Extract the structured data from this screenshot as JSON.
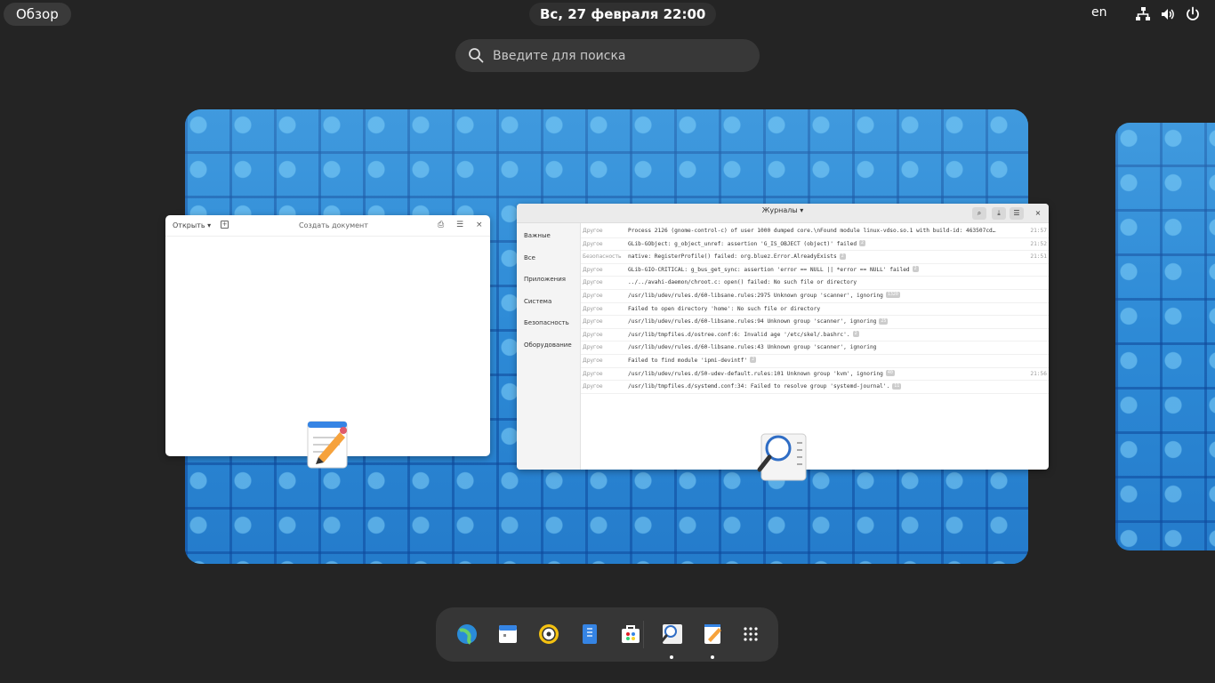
{
  "topbar": {
    "activities_label": "Обзор",
    "clock": "Вс, 27 февраля  22:00",
    "keyboard_layout": "en",
    "tray_icons": [
      "network-icon",
      "volume-icon",
      "power-icon"
    ]
  },
  "search": {
    "placeholder": "Введите для поиска"
  },
  "editor_window": {
    "open_label": "Открыть",
    "title": "Создать документ"
  },
  "logs_window": {
    "title": "Журналы",
    "sidebar": [
      "Важные",
      "Все",
      "Приложения",
      "Система",
      "Безопасность",
      "Оборудование"
    ],
    "rows": [
      {
        "category": "Другое",
        "message": "Process 2126 (gnome-control-c) of user 1000 dumped core.\\nFound module linux-vdso.so.1 with build-id: 463507cd…",
        "count": "",
        "time": "21:57"
      },
      {
        "category": "Другое",
        "message": "GLib-GObject: g_object_unref: assertion 'G_IS_OBJECT (object)' failed",
        "count": "2",
        "time": "21:52"
      },
      {
        "category": "Безопасность",
        "message": "native: RegisterProfile() failed: org.bluez.Error.AlreadyExists",
        "count": "2",
        "time": "21:51"
      },
      {
        "category": "Другое",
        "message": "GLib-GIO-CRITICAL: g_bus_get_sync: assertion 'error == NULL || *error == NULL' failed",
        "count": "2",
        "time": ""
      },
      {
        "category": "Другое",
        "message": "../../avahi-daemon/chroot.c: open() failed: No such file or directory",
        "count": "",
        "time": ""
      },
      {
        "category": "Другое",
        "message": "/usr/lib/udev/rules.d/60-libsane.rules:2975 Unknown group 'scanner', ignoring",
        "count": "1320",
        "time": ""
      },
      {
        "category": "Другое",
        "message": "Failed to open directory 'home': No such file or directory",
        "count": "",
        "time": ""
      },
      {
        "category": "Другое",
        "message": "/usr/lib/udev/rules.d/60-libsane.rules:94 Unknown group 'scanner', ignoring",
        "count": "25",
        "time": ""
      },
      {
        "category": "Другое",
        "message": "/usr/lib/tmpfiles.d/ostree.conf:6: Invalid age '/etc/skel/.bashrc'.",
        "count": "2",
        "time": ""
      },
      {
        "category": "Другое",
        "message": "/usr/lib/udev/rules.d/60-libsane.rules:43 Unknown group 'scanner', ignoring",
        "count": "",
        "time": ""
      },
      {
        "category": "Другое",
        "message": "Failed to find module 'ipmi-devintf'",
        "count": "2",
        "time": ""
      },
      {
        "category": "Другое",
        "message": "/usr/lib/udev/rules.d/50-udev-default.rules:101 Unknown group 'kvm', ignoring",
        "count": "40",
        "time": "21:56"
      },
      {
        "category": "Другое",
        "message": "/usr/lib/tmpfiles.d/systemd.conf:34: Failed to resolve group 'systemd-journal'.",
        "count": "11",
        "time": ""
      }
    ]
  },
  "dash": {
    "apps": [
      "web-browser-icon",
      "calendar-icon",
      "music-player-icon",
      "files-icon",
      "software-icon",
      "logs-icon",
      "text-editor-icon",
      "app-grid-icon"
    ],
    "running": [
      "logs-icon",
      "text-editor-icon"
    ]
  },
  "colors": {
    "background": "#242424",
    "wallpaper": "#2d8ad6"
  }
}
